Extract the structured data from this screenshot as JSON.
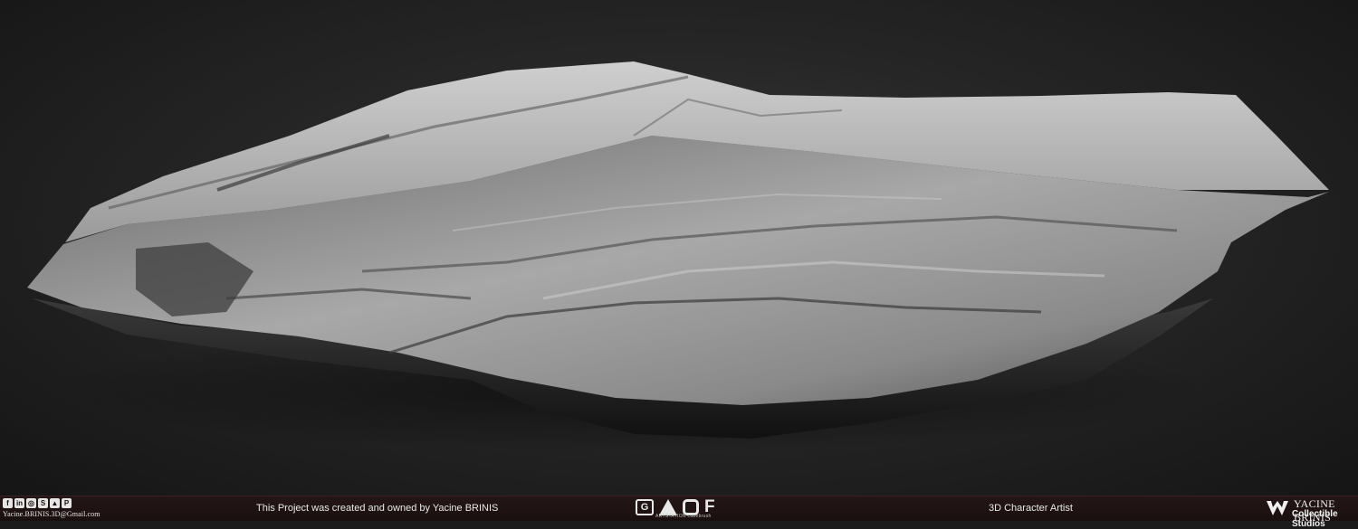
{
  "scene": {
    "subject": "rock-sculpt",
    "colors": {
      "background": "#222222",
      "rock_light": "#d8d8d8",
      "rock_mid": "#8e8e8e",
      "rock_dark": "#2e2e2e",
      "footer_bg": "#1f1212"
    }
  },
  "footer": {
    "social_icons": [
      "facebook-icon",
      "linkedin-icon",
      "instagram-icon",
      "skype-icon",
      "artstation-icon",
      "pinterest-icon"
    ],
    "social_glyphs": [
      "f",
      "in",
      "◎",
      "S",
      "▲",
      "P"
    ],
    "email": "Yacine.BRINIS.3D@Gmail.com",
    "credit": "This Project was created and owned by Yacine BRINIS",
    "logos_caption": "ARTSTATION  cubebrush",
    "role": "3D Character Artist",
    "brand_name": "YACINE BRINIS",
    "brand_sub": "Collectible Studios"
  }
}
